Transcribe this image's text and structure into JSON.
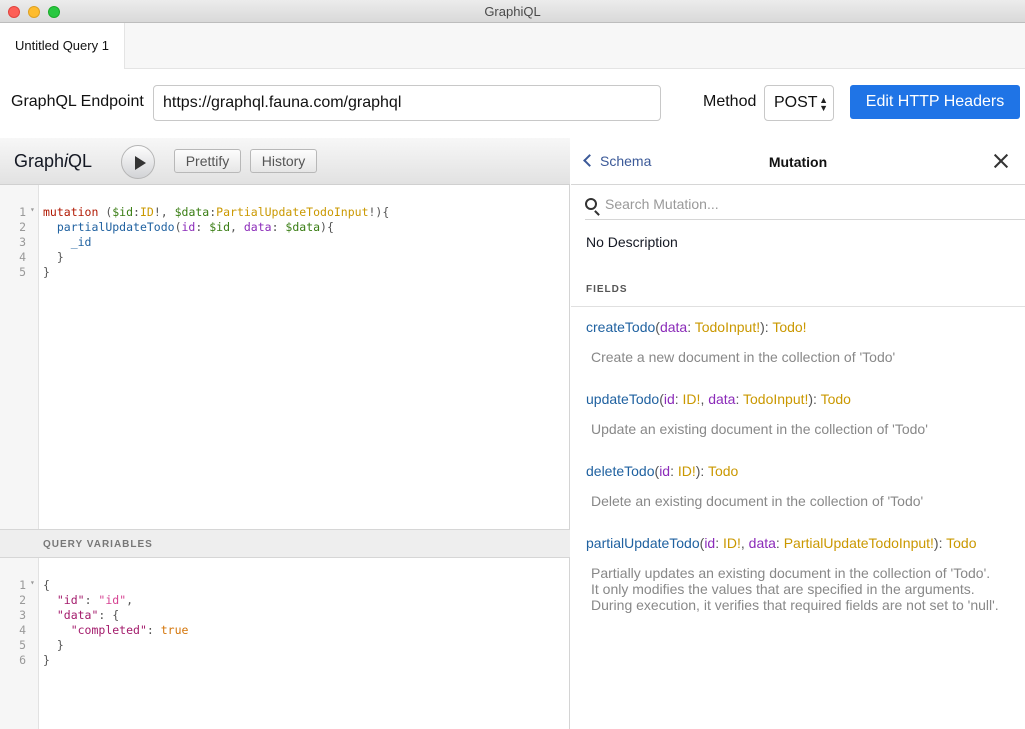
{
  "window": {
    "title": "GraphiQL"
  },
  "tabs": [
    {
      "label": "Untitled Query 1"
    }
  ],
  "endpoint": {
    "label": "GraphQL Endpoint",
    "value": "https://graphql.fauna.com/graphql",
    "method_label": "Method",
    "method_value": "POST",
    "headers_button": "Edit HTTP Headers"
  },
  "toolbar": {
    "brand_prefix": "Graph",
    "brand_italic": "i",
    "brand_suffix": "QL",
    "prettify": "Prettify",
    "history": "History"
  },
  "query_editor": {
    "lines": [
      {
        "n": "1",
        "fold": true,
        "tokens": [
          [
            "kw",
            "mutation"
          ],
          [
            "punc",
            " ("
          ],
          [
            "var",
            "$id"
          ],
          [
            "punc",
            ":"
          ],
          [
            "tname",
            "ID"
          ],
          [
            "punc",
            "!, "
          ],
          [
            "var",
            "$data"
          ],
          [
            "punc",
            ":"
          ],
          [
            "tname",
            "PartialUpdateTodoInput"
          ],
          [
            "punc",
            "!){"
          ]
        ]
      },
      {
        "n": "2",
        "fold": false,
        "tokens": [
          [
            "punc",
            "  "
          ],
          [
            "fld",
            "partialUpdateTodo"
          ],
          [
            "punc",
            "("
          ],
          [
            "arg",
            "id"
          ],
          [
            "punc",
            ": "
          ],
          [
            "var",
            "$id"
          ],
          [
            "punc",
            ", "
          ],
          [
            "arg",
            "data"
          ],
          [
            "punc",
            ": "
          ],
          [
            "var",
            "$data"
          ],
          [
            "punc",
            "){"
          ]
        ]
      },
      {
        "n": "3",
        "fold": false,
        "tokens": [
          [
            "punc",
            "    "
          ],
          [
            "fld",
            "_id"
          ]
        ]
      },
      {
        "n": "4",
        "fold": false,
        "tokens": [
          [
            "punc",
            "  }"
          ]
        ]
      },
      {
        "n": "5",
        "fold": false,
        "tokens": [
          [
            "punc",
            "}"
          ]
        ]
      }
    ]
  },
  "variables": {
    "title": "QUERY VARIABLES",
    "lines": [
      {
        "n": "1",
        "fold": true,
        "tokens": [
          [
            "punc",
            "{"
          ]
        ]
      },
      {
        "n": "2",
        "fold": false,
        "tokens": [
          [
            "punc",
            "  "
          ],
          [
            "key",
            "\"id\""
          ],
          [
            "punc",
            ": "
          ],
          [
            "str",
            "\"id\""
          ],
          [
            "punc",
            ","
          ]
        ]
      },
      {
        "n": "3",
        "fold": false,
        "tokens": [
          [
            "punc",
            "  "
          ],
          [
            "key",
            "\"data\""
          ],
          [
            "punc",
            ": {"
          ]
        ]
      },
      {
        "n": "4",
        "fold": false,
        "tokens": [
          [
            "punc",
            "    "
          ],
          [
            "key",
            "\"completed\""
          ],
          [
            "punc",
            ": "
          ],
          [
            "bool",
            "true"
          ]
        ]
      },
      {
        "n": "5",
        "fold": false,
        "tokens": [
          [
            "punc",
            "  }"
          ]
        ]
      },
      {
        "n": "6",
        "fold": false,
        "tokens": [
          [
            "punc",
            "}"
          ]
        ]
      }
    ]
  },
  "docs": {
    "back_label": "Schema",
    "title": "Mutation",
    "search_placeholder": "Search Mutation...",
    "no_description": "No Description",
    "fields_header": "FIELDS",
    "fields": [
      {
        "name": "createTodo",
        "args": [
          {
            "name": "data",
            "type": "TodoInput!"
          }
        ],
        "return": "Todo!",
        "description": [
          "Create a new document in the collection of 'Todo'"
        ]
      },
      {
        "name": "updateTodo",
        "args": [
          {
            "name": "id",
            "type": "ID!"
          },
          {
            "name": "data",
            "type": "TodoInput!"
          }
        ],
        "return": "Todo",
        "description": [
          "Update an existing document in the collection of 'Todo'"
        ]
      },
      {
        "name": "deleteTodo",
        "args": [
          {
            "name": "id",
            "type": "ID!"
          }
        ],
        "return": "Todo",
        "description": [
          "Delete an existing document in the collection of 'Todo'"
        ]
      },
      {
        "name": "partialUpdateTodo",
        "args": [
          {
            "name": "id",
            "type": "ID!"
          },
          {
            "name": "data",
            "type": "PartialUpdateTodoInput!"
          }
        ],
        "return": "Todo",
        "description": [
          "Partially updates an existing document in the collection of 'Todo'.",
          "It only modifies the values that are specified in the arguments.",
          "During execution, it verifies that required fields are not set to 'null'."
        ]
      }
    ]
  },
  "colors": {
    "accent_button": "#1f74e6",
    "keyword": "#b11a04",
    "variable": "#397d13",
    "type": "#ca9800",
    "field": "#1f61a0",
    "argument": "#8b2bb9"
  }
}
